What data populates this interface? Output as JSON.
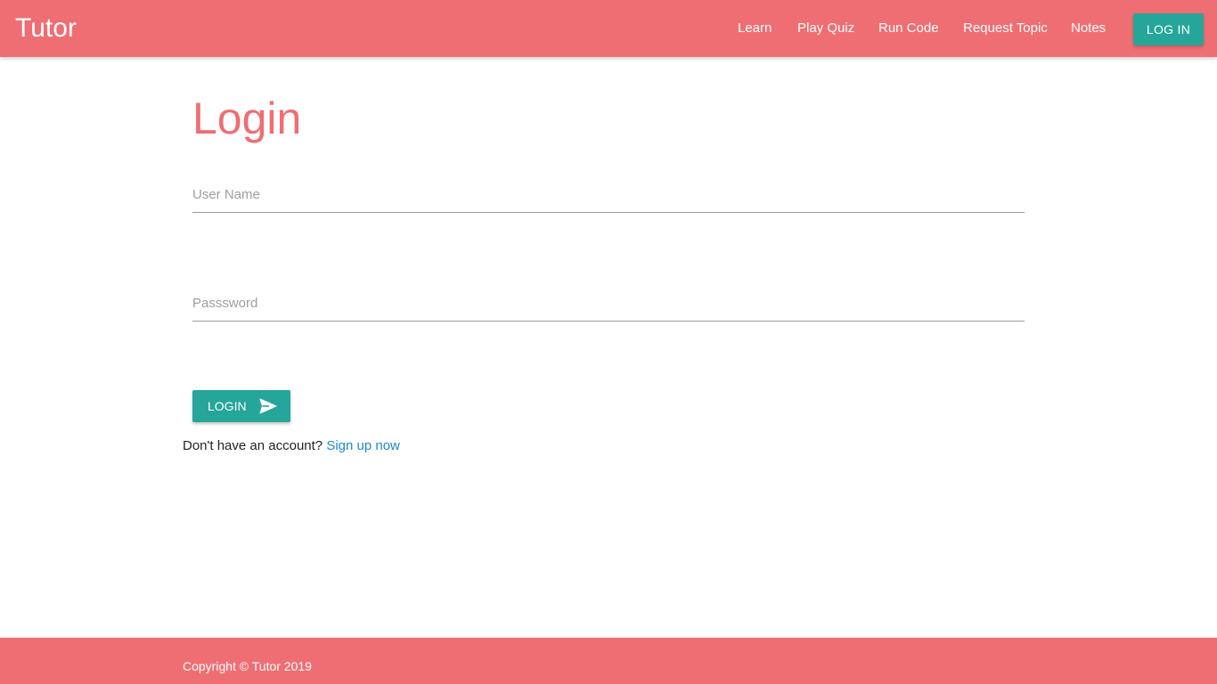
{
  "brand": {
    "name": "Tutor"
  },
  "nav": {
    "links": [
      "Learn",
      "Play Quiz",
      "Run Code",
      "Request Topic",
      "Notes"
    ],
    "login_label": "LOG IN"
  },
  "colors": {
    "primary": "#ef6e73",
    "accent": "#26a69a",
    "link": "#1e88c8"
  },
  "form": {
    "title": "Login",
    "username": {
      "placeholder": "User Name",
      "value": ""
    },
    "password": {
      "placeholder": "Passsword",
      "value": ""
    },
    "submit_label": "LOGIN",
    "submit_icon": "send-icon",
    "signup_prompt": "Don't have an account?",
    "signup_link": "Sign up now"
  },
  "footer": {
    "copyright": "Copyright © Tutor 2019"
  }
}
